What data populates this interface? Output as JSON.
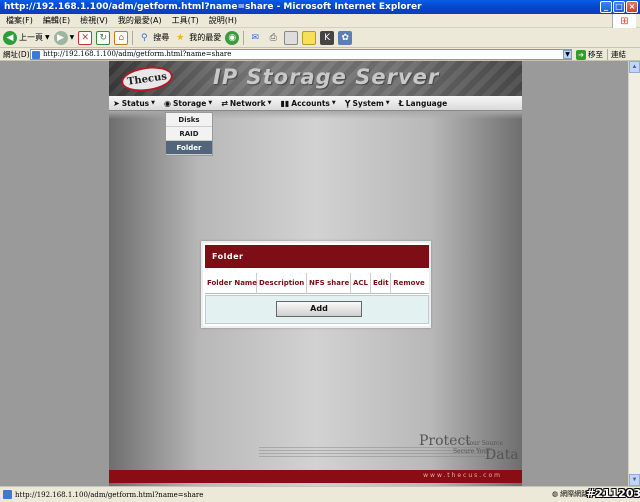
{
  "window": {
    "title": "http://192.168.1.100/adm/getform.html?name=share - Microsoft Internet Explorer",
    "minimize": "_",
    "maximize": "□",
    "close": "×"
  },
  "menubar": {
    "items": [
      "檔案(F)",
      "編輯(E)",
      "檢視(V)",
      "我的最愛(A)",
      "工具(T)",
      "說明(H)"
    ]
  },
  "toolbar": {
    "back_label": "上一頁",
    "search_label": "搜尋",
    "favorites_label": "我的最愛"
  },
  "addressbar": {
    "label": "網址(D)",
    "url": "http://192.168.1.100/adm/getform.html?name=share",
    "go_label": "移至",
    "links_label": "連結"
  },
  "page": {
    "logo": "Thecus",
    "header_title": "IP Storage Server",
    "nav": {
      "items": [
        {
          "label": "Status"
        },
        {
          "label": "Storage"
        },
        {
          "label": "Network"
        },
        {
          "label": "Accounts"
        },
        {
          "label": "System"
        },
        {
          "label": "Language"
        }
      ]
    },
    "dropdown": {
      "items": [
        "Disks",
        "RAID",
        "Folder"
      ],
      "active": "Folder"
    },
    "folder_panel": {
      "title": "Folder",
      "columns": [
        "Folder Name",
        "Description",
        "NFS share",
        "ACL",
        "Edit",
        "Remove"
      ],
      "add_label": "Add"
    },
    "slogan": {
      "protect": "Protect",
      "your_source": "Your Source",
      "secure_your": "Secure Your",
      "data": "Data"
    },
    "footer_url": "www.thecus.com"
  },
  "statusbar": {
    "text": "http://192.168.1.100/adm/getform.html?name=share",
    "zone": "網際網路"
  },
  "watermark": "#211203"
}
